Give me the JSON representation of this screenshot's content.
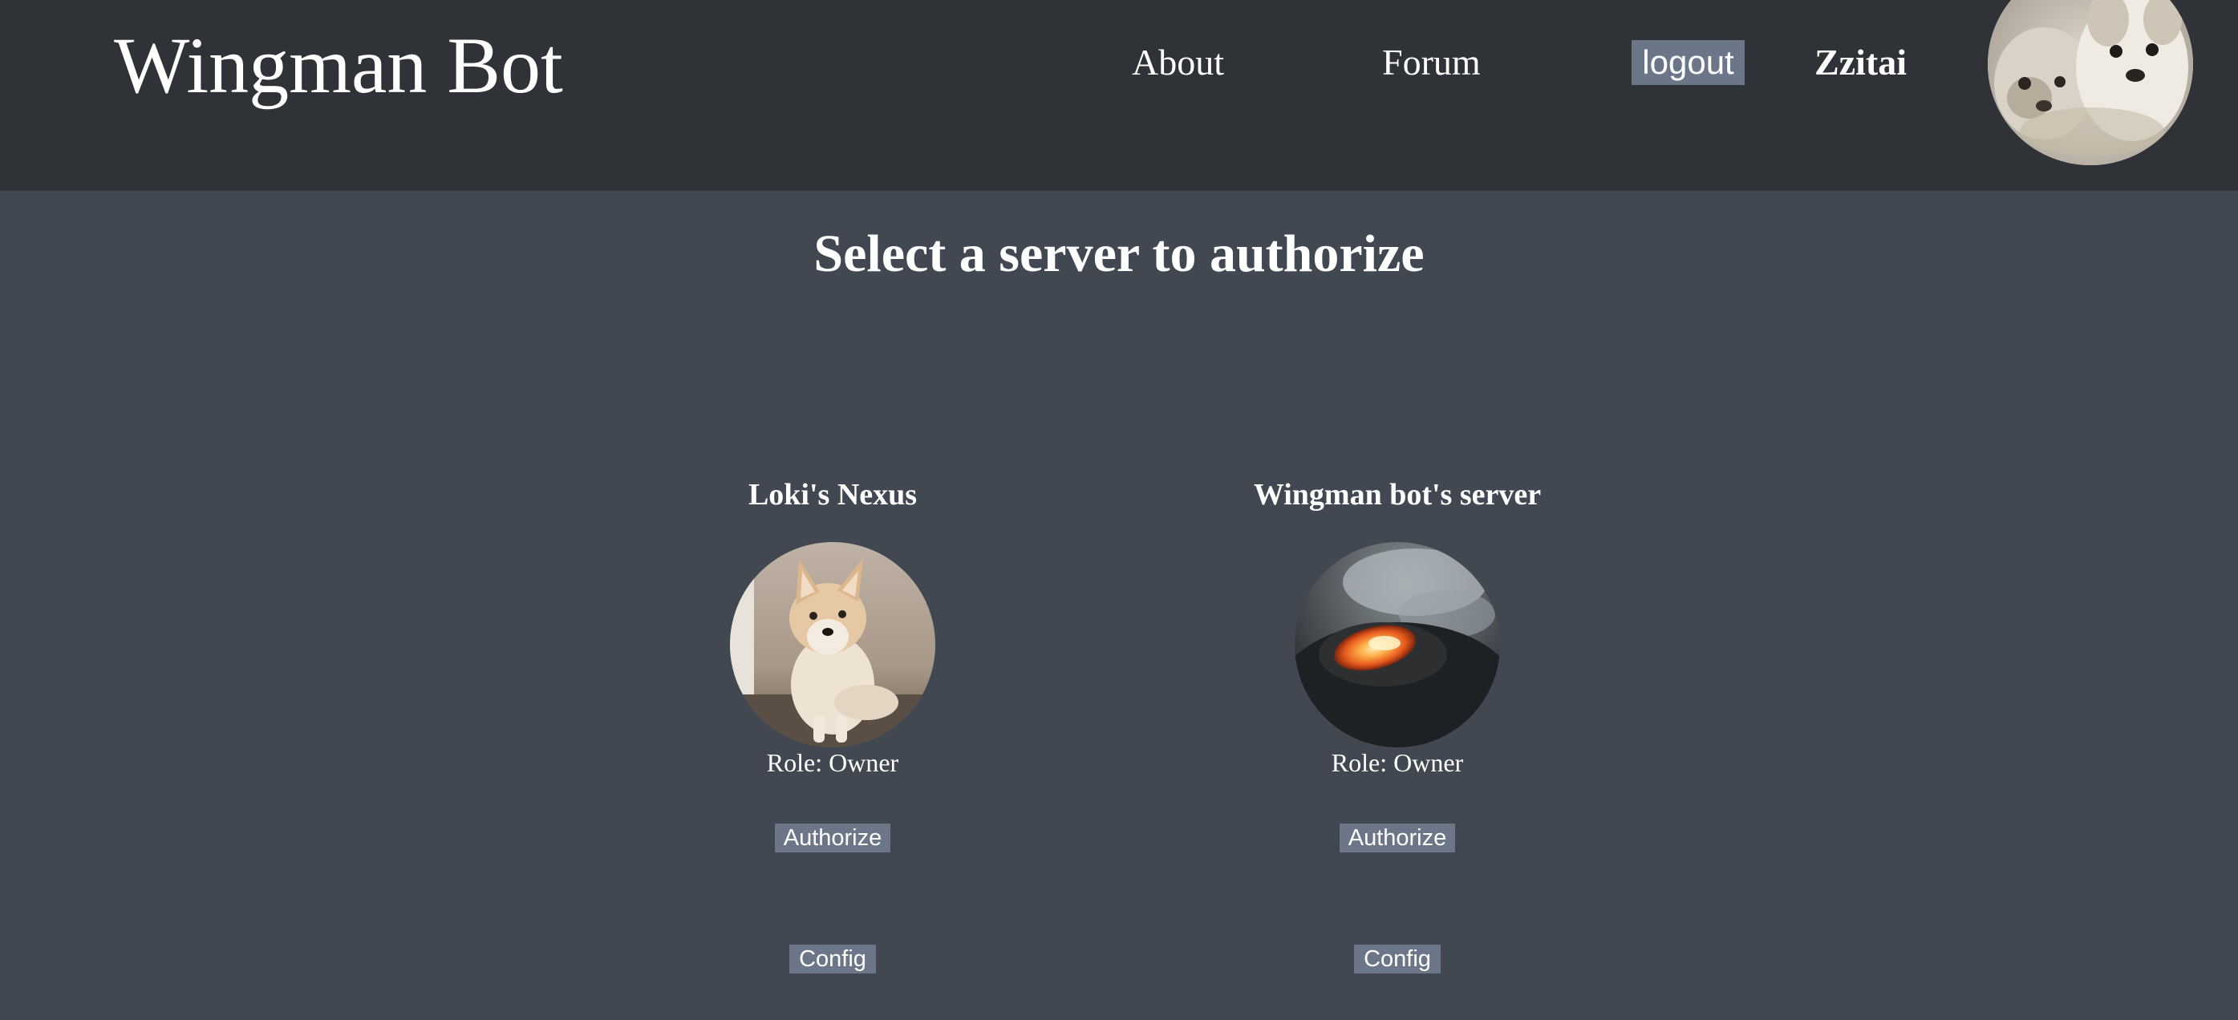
{
  "header": {
    "brand": "Wingman Bot",
    "nav": {
      "about": "About",
      "forum": "Forum",
      "logout": "logout"
    },
    "username": "Zzitai",
    "avatar_icon": "user-avatar-photo-dogs"
  },
  "main": {
    "title": "Select a server to authorize",
    "servers": [
      {
        "name": "Loki's Nexus",
        "role": "Role: Owner",
        "authorize_label": "Authorize",
        "config_label": "Config",
        "icon": "dog-photo"
      },
      {
        "name": "Wingman bot's server",
        "role": "Role: Owner",
        "authorize_label": "Authorize",
        "config_label": "Config",
        "icon": "volcano-photo"
      }
    ]
  },
  "colors": {
    "header_bg": "#2f3236",
    "page_bg": "#414852",
    "button_bg": "#6b7788",
    "text": "#ffffff"
  }
}
